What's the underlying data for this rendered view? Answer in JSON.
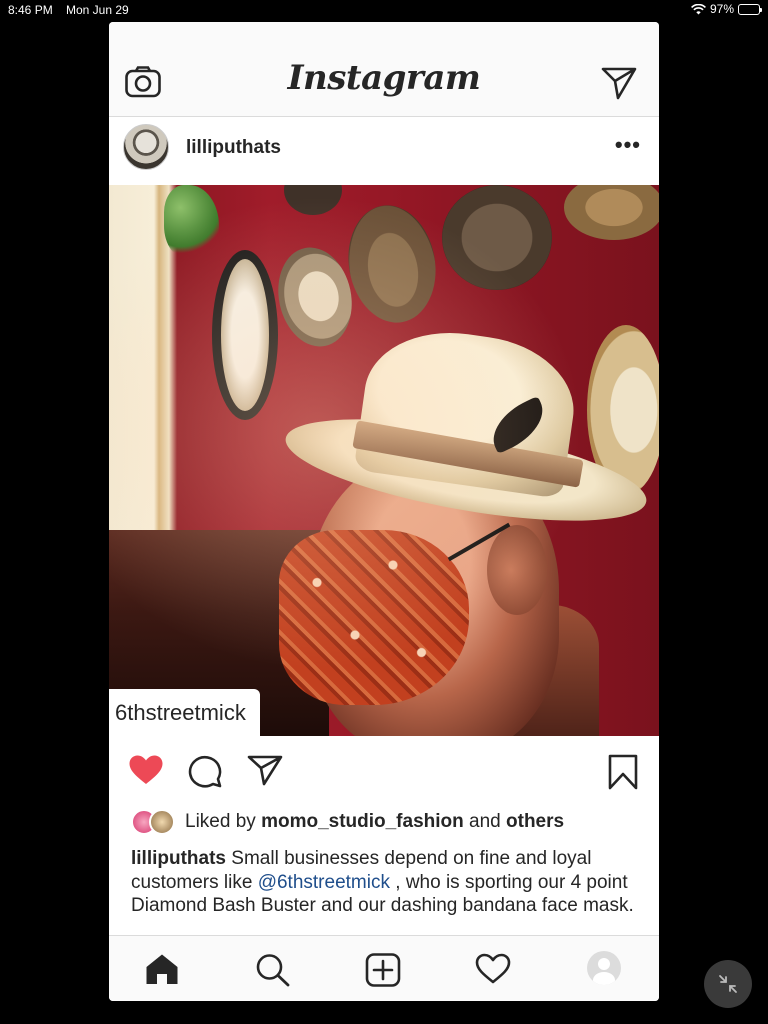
{
  "status_bar": {
    "time": "8:46 PM",
    "date": "Mon Jun 29",
    "battery_text": "97%",
    "battery_level": 0.97
  },
  "app_header": {
    "logo": "Instagram",
    "left_icon": "camera-icon",
    "right_icon": "direct-message-icon"
  },
  "post": {
    "username": "lilliputhats",
    "more_icon": "more-options-icon",
    "photo_tag": "6thstreetmick",
    "liked": true,
    "likes": {
      "prefix": "Liked by",
      "user": "momo_studio_fashion",
      "conjunction": "and",
      "others": "others"
    },
    "caption": {
      "username": "lilliputhats",
      "text_before": " Small businesses depend on fine and loyal customers like ",
      "mention": "@6thstreetmick",
      "text_after": " , who is sporting our 4 point Diamond Bash Buster and our dashing bandana face mask."
    }
  },
  "action_icons": [
    "heart-icon",
    "comment-icon",
    "share-icon",
    "bookmark-icon"
  ],
  "bottom_nav_icons": [
    "home-icon",
    "search-icon",
    "add-post-icon",
    "activity-heart-icon",
    "profile-icon"
  ],
  "colors": {
    "like_red": "#ed4956",
    "mention_blue": "#1f4e8b",
    "text": "#262626"
  }
}
